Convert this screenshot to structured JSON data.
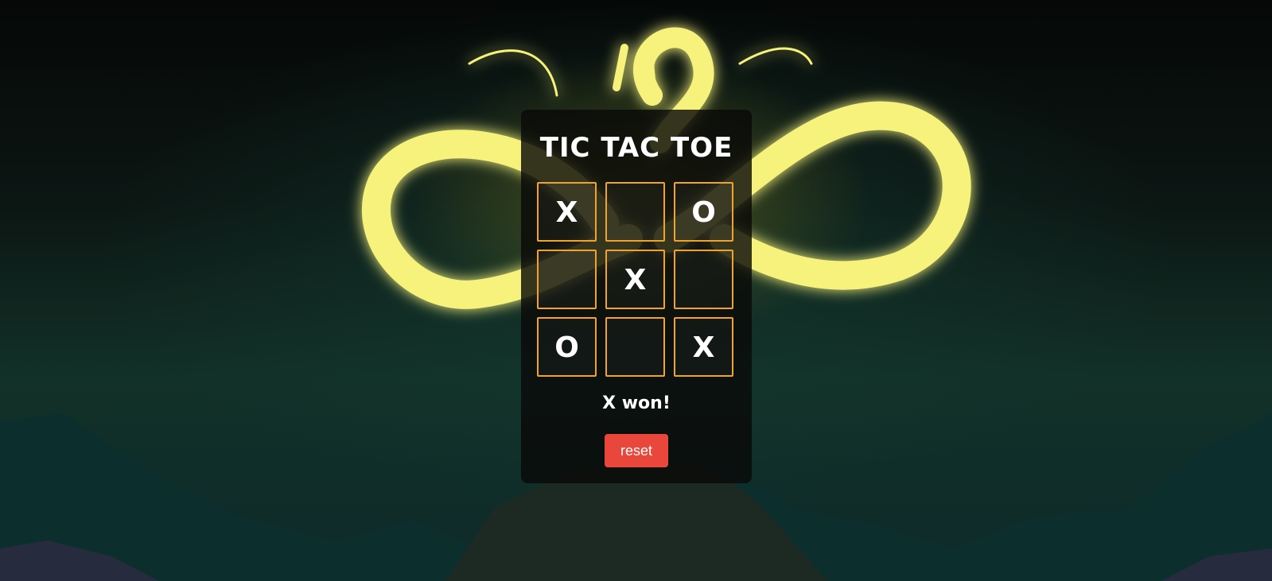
{
  "game": {
    "title": "TIC TAC TOE",
    "board": [
      "X",
      "",
      "O",
      "",
      "X",
      "",
      "O",
      "",
      "X"
    ],
    "status": "X won!",
    "reset_label": "reset"
  },
  "colors": {
    "cell_border": "#f3a22c",
    "reset_button": "#e9473b",
    "panel": "#0a0a08",
    "dragon_glow": "#f8f27a"
  }
}
